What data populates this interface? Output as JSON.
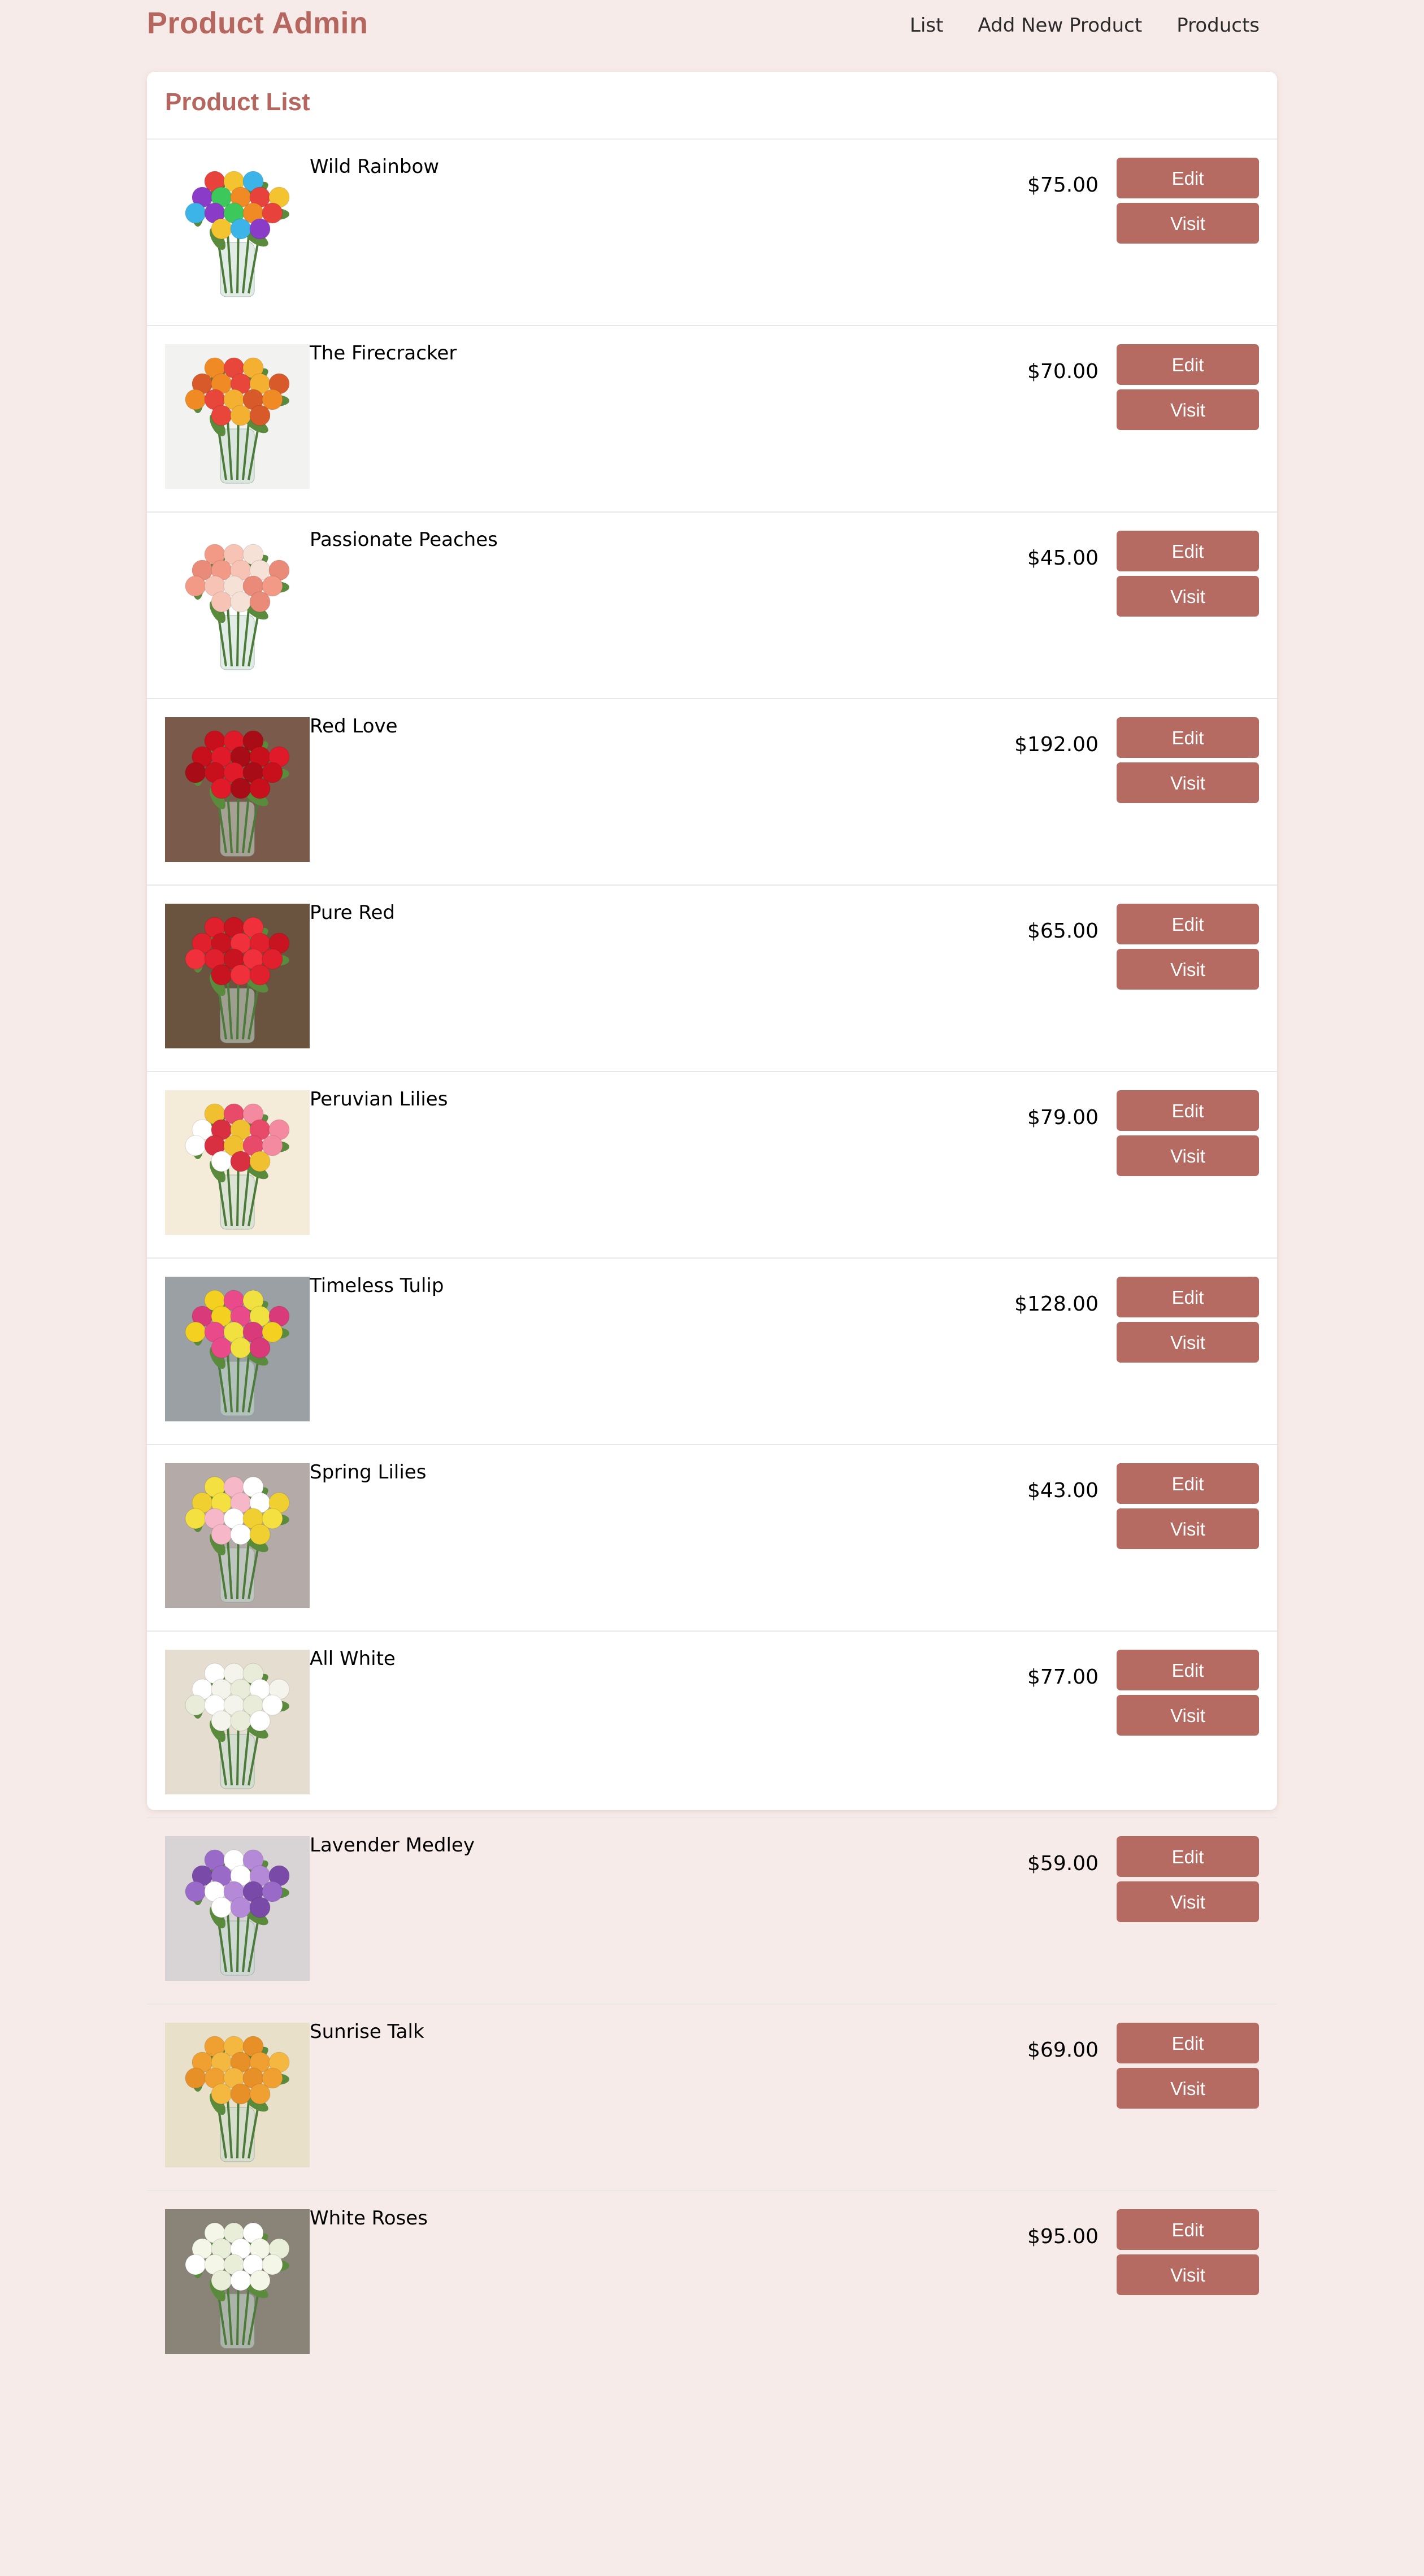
{
  "header": {
    "brand": "Product Admin",
    "nav": [
      "List",
      "Add New Product",
      "Products"
    ]
  },
  "panel": {
    "title": "Product List"
  },
  "products": [
    {
      "name": "Wild Rainbow",
      "price": "$75.00",
      "edit": "Edit",
      "visit": "Visit",
      "bg": "#ffffff",
      "flowers": [
        "#e8423c",
        "#f4c430",
        "#3cb4e8",
        "#8a3cc8",
        "#3cc85a",
        "#f08a24"
      ]
    },
    {
      "name": "The Firecracker",
      "price": "$70.00",
      "edit": "Edit",
      "visit": "Visit",
      "bg": "#f2f2f0",
      "flowers": [
        "#f08a24",
        "#e8463a",
        "#f4b030",
        "#d85a2a"
      ]
    },
    {
      "name": "Passionate Peaches",
      "price": "$45.00",
      "edit": "Edit",
      "visit": "Visit",
      "bg": "#ffffff",
      "flowers": [
        "#f39a86",
        "#f7c3b4",
        "#f5e1d6",
        "#ea8a78"
      ]
    },
    {
      "name": "Red Love",
      "price": "$192.00",
      "edit": "Edit",
      "visit": "Visit",
      "bg": "#7a5a4a",
      "flowers": [
        "#c8101c",
        "#e01a28",
        "#a80c16"
      ]
    },
    {
      "name": "Pure Red",
      "price": "$65.00",
      "edit": "Edit",
      "visit": "Visit",
      "bg": "#6a5440",
      "flowers": [
        "#e0202c",
        "#c81420",
        "#f0303a"
      ]
    },
    {
      "name": "Peruvian Lilies",
      "price": "$79.00",
      "edit": "Edit",
      "visit": "Visit",
      "bg": "#f4ecd8",
      "flowers": [
        "#f0c030",
        "#e84a6a",
        "#f48aa0",
        "#ffffff",
        "#d83040"
      ]
    },
    {
      "name": "Timeless Tulip",
      "price": "$128.00",
      "edit": "Edit",
      "visit": "Visit",
      "bg": "#9aa0a4",
      "flowers": [
        "#f4d020",
        "#e84a8a",
        "#f0e040",
        "#d83a7a"
      ]
    },
    {
      "name": "Spring Lilies",
      "price": "$43.00",
      "edit": "Edit",
      "visit": "Visit",
      "bg": "#b4aaa8",
      "flowers": [
        "#f4e040",
        "#f6b8c8",
        "#ffffff",
        "#f0d030"
      ]
    },
    {
      "name": "All White",
      "price": "$77.00",
      "edit": "Edit",
      "visit": "Visit",
      "bg": "#e4ddd0",
      "flowers": [
        "#ffffff",
        "#f4f4ec",
        "#e8ecd8"
      ]
    },
    {
      "name": "Lavender Medley",
      "price": "$59.00",
      "edit": "Edit",
      "visit": "Visit",
      "bg": "#d8d4d6",
      "flowers": [
        "#9a6ac8",
        "#ffffff",
        "#b48ad8",
        "#7a4aa8"
      ]
    },
    {
      "name": "Sunrise Talk",
      "price": "$69.00",
      "edit": "Edit",
      "visit": "Visit",
      "bg": "#e8e0c8",
      "flowers": [
        "#f0a030",
        "#f4b840",
        "#e89028"
      ]
    },
    {
      "name": "White Roses",
      "price": "$95.00",
      "edit": "Edit",
      "visit": "Visit",
      "bg": "#8a8478",
      "flowers": [
        "#f4f6e8",
        "#e8eed8",
        "#ffffff"
      ]
    }
  ]
}
